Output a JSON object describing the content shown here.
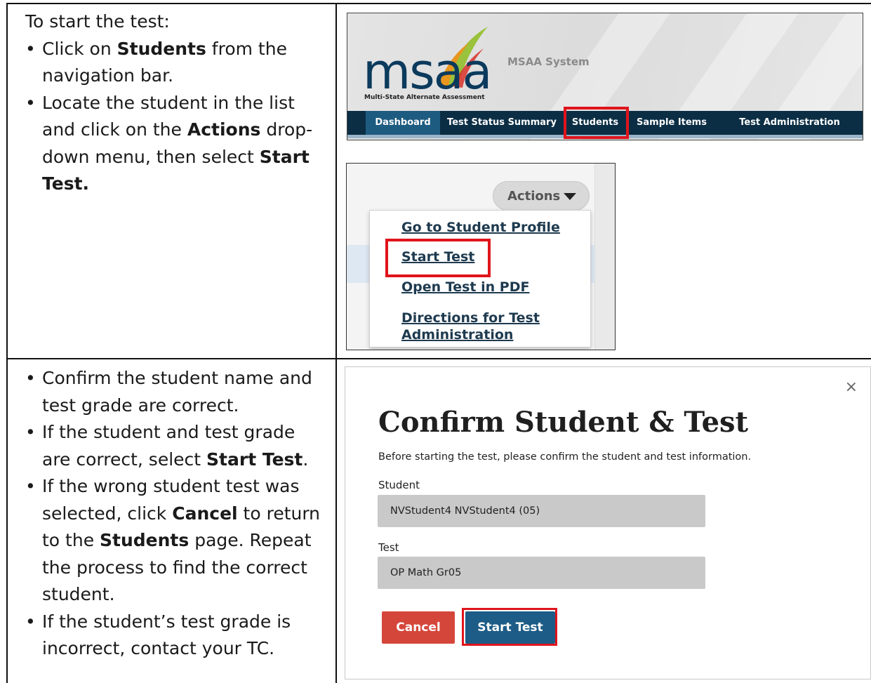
{
  "row1": {
    "intro": "To start the test:",
    "bullets": [
      {
        "pre": "Click on ",
        "bold": "Students",
        "post": " from the navigation bar."
      },
      {
        "pre": "Locate the student in the list and click on the ",
        "bold": "Actions",
        "post": " drop-down menu, then select ",
        "bold2": "Start Test."
      }
    ]
  },
  "row2": {
    "bullets": [
      {
        "text": "Confirm the student name and test grade are correct."
      },
      {
        "pre": "If the student and test grade are correct, select ",
        "bold": "Start Test",
        "post": "."
      },
      {
        "pre": "If the wrong student test was selected, click ",
        "bold": "Cancel",
        "post": " to return to the ",
        "bold2": "Students",
        "post2": " page. Repeat the process to find the correct student."
      },
      {
        "text": "If the student’s test grade is incorrect, contact your TC."
      }
    ]
  },
  "bullet_char": "•",
  "msaa": {
    "logo_text": "msaa",
    "logo_subtitle": "Multi-State Alternate Assessment",
    "system_title": "MSAA System",
    "nav": [
      {
        "label": "Dashboard",
        "active": true
      },
      {
        "label": "Test Status Summary"
      },
      {
        "label": "Students",
        "highlighted": true
      },
      {
        "label": "Sample Items"
      },
      {
        "label": "Test Administration Training"
      }
    ],
    "colors": {
      "navbar": "#0b2e45",
      "active": "#1e5b80",
      "highlight": "#e0141c"
    }
  },
  "actions": {
    "button_label": "Actions",
    "caret_icon": "caret-down-icon",
    "menu": [
      "Go to Student Profile",
      "Start Test",
      "Open Test in PDF",
      "Directions for Test Administration"
    ],
    "highlighted_item": "Start Test"
  },
  "confirm": {
    "close_icon": "×",
    "title": "Confirm Student & Test",
    "description": "Before starting the test, please confirm the student and test information.",
    "student_label": "Student",
    "student_value": "NVStudent4 NVStudent4 (05)",
    "test_label": "Test",
    "test_value": "OP Math Gr05",
    "cancel_label": "Cancel",
    "start_label": "Start Test",
    "colors": {
      "cancel": "#d5463a",
      "start": "#1d5c86"
    }
  }
}
